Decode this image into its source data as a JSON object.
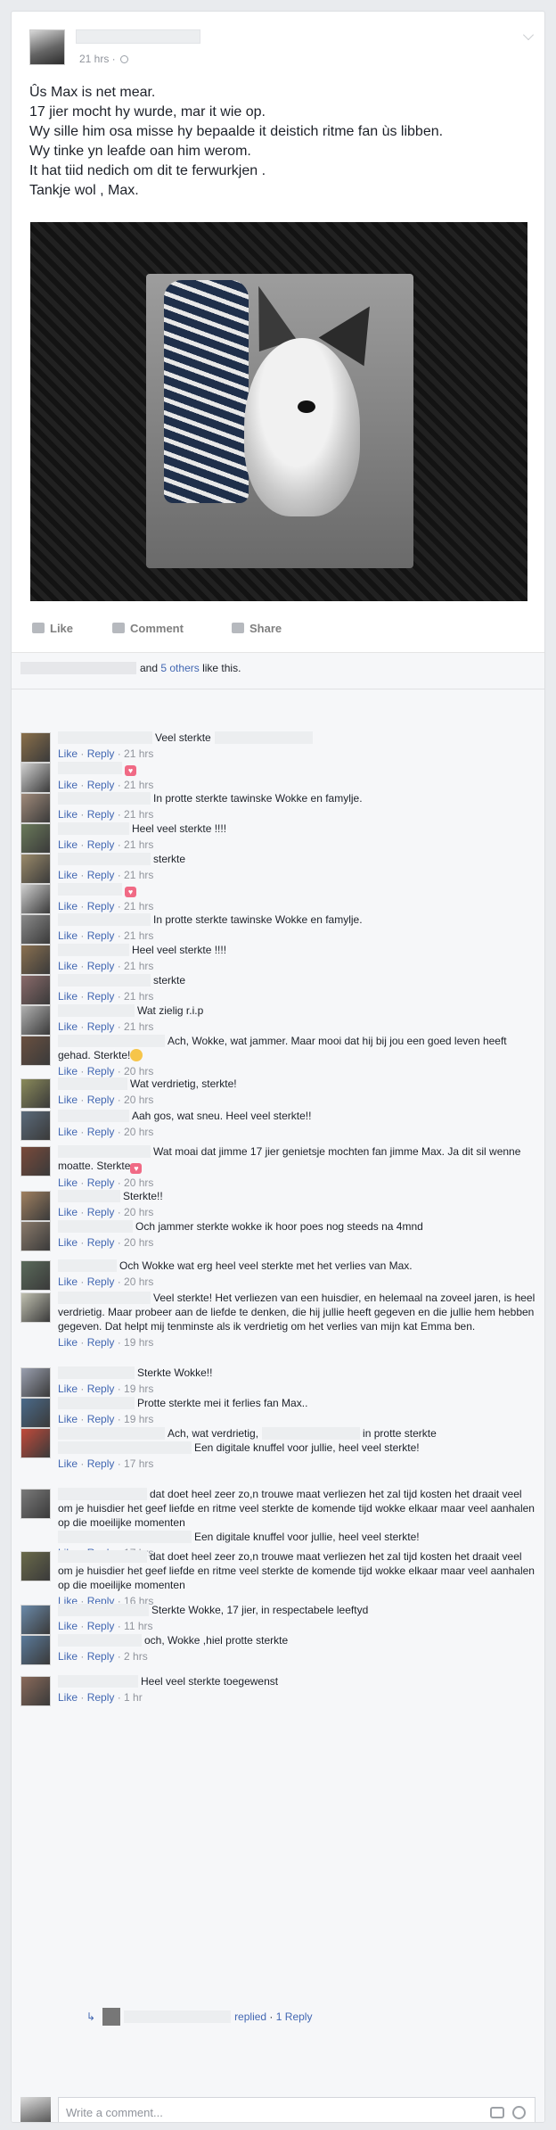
{
  "post": {
    "time": "21 hrs ·",
    "lines": [
      "Ûs Max is net mear.",
      "17 jier mocht hy wurde, mar it wie op.",
      "Wy sille him osa misse hy bepaalde it deistich ritme fan ùs libben.",
      "Wy tinke yn leafde oan him werom.",
      "It hat tiid nedich om dit te ferwurkjen .",
      "Tankje wol , Max."
    ]
  },
  "actions": {
    "like": "Like",
    "comment": "Comment",
    "share": "Share"
  },
  "likes": {
    "and": "and",
    "others": "5 others",
    "suffix": "like this."
  },
  "comment_actions": {
    "like": "Like",
    "reply": "Reply"
  },
  "comments": [
    {
      "text": "Veel sterkte",
      "time": "21 hrs",
      "trail": true
    },
    {
      "text": "",
      "time": "21 hrs",
      "heart": true
    },
    {
      "text": "In protte sterkte tawinske Wokke en famylje.",
      "time": "21 hrs"
    },
    {
      "text": "Heel veel sterkte !!!!",
      "time": "21 hrs"
    },
    {
      "text": "sterkte",
      "time": "21 hrs"
    },
    {
      "text": "",
      "time": "21 hrs",
      "heart": true
    },
    {
      "text": "In protte sterkte tawinske Wokke en famylje.",
      "time": "21 hrs"
    },
    {
      "text": "Heel veel sterkte !!!!",
      "time": "21 hrs"
    },
    {
      "text": "sterkte",
      "time": "21 hrs"
    },
    {
      "text": "Wat zielig r.i.p",
      "time": "21 hrs"
    },
    {
      "text": "Ach, Wokke, wat jammer. Maar mooi dat hij bij jou een goed leven heeft gehad. Sterkte!",
      "time": "20 hrs",
      "smiley": true
    },
    {
      "text": "Wat verdrietig, sterkte!",
      "time": "20 hrs"
    },
    {
      "text": "Aah gos, wat sneu. Heel veel sterkte!!",
      "time": "20 hrs"
    },
    {
      "text": "Wat moai dat jimme 17 jier genietsje mochten fan jimme Max. Ja dit sil wenne moatte. Sterkte",
      "time": "20 hrs",
      "heart": true
    },
    {
      "text": "Sterkte!!",
      "time": "20 hrs"
    },
    {
      "text": "Och jammer sterkte wokke ik hoor poes nog steeds na 4mnd",
      "time": "20 hrs"
    },
    {
      "text": "Och Wokke wat erg heel veel sterkte met het verlies van Max.",
      "time": "20 hrs"
    },
    {
      "text": "Veel sterkte! Het verliezen van een huisdier, en helemaal na zoveel jaren, is heel verdrietig. Maar probeer aan de liefde te denken, die hij jullie heeft gegeven en die jullie hem hebben gegeven. Dat helpt mij tenminste als ik verdrietig om het verlies van mijn kat Emma ben.",
      "time": "19 hrs"
    },
    {
      "text": "Sterkte Wokke!!",
      "time": "19 hrs"
    },
    {
      "text": "Protte sterkte mei it ferlies fan Max..",
      "time": "19 hrs"
    },
    {
      "text": "Ach, wat verdrietig,",
      "text2": "in protte sterkte",
      "text3": "Een digitale knuffel voor jullie, heel veel sterkte!",
      "time": "17 hrs"
    },
    {
      "text": "dat doet heel zeer zo,n trouwe maat verliezen het zal tijd kosten het draait veel om je huisdier het geef liefde en ritme veel sterkte de komende tijd wokke elkaar maar veel aanhalen op die moeilijke momenten",
      "text3": "Een digitale knuffel voor jullie, heel veel sterkte!",
      "time": "17 hrs"
    },
    {
      "text": "dat doet heel zeer zo,n trouwe maat verliezen het zal tijd kosten het draait veel om je huisdier het geef liefde en ritme veel sterkte de komende tijd wokke elkaar maar veel aanhalen op die moeilijke momenten",
      "time": "16 hrs"
    },
    {
      "text": "Sterkte Wokke, 17 jier, in respectabele leeftyd",
      "time": "11 hrs"
    },
    {
      "text": "och, Wokke ,hiel protte sterkte",
      "time": "2 hrs"
    },
    {
      "text": "Heel veel sterkte toegewenst",
      "time": "1 hr"
    }
  ],
  "reply": {
    "label": "replied",
    "count": "1 Reply"
  },
  "write_placeholder": "Write a comment..."
}
